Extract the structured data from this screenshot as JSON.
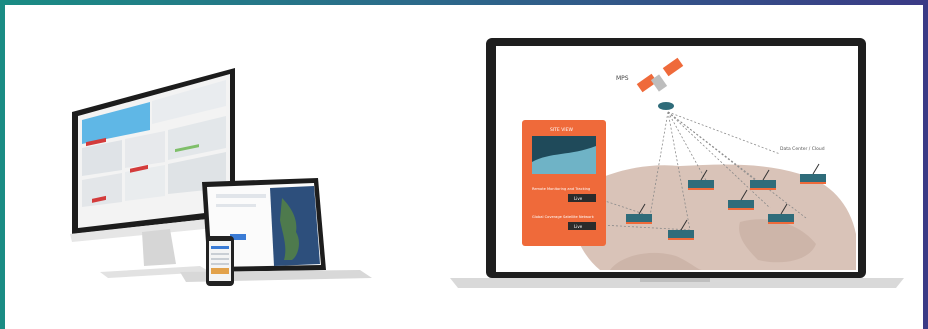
{
  "colors": {
    "border_left": "#1a8c84",
    "border_top_right": "#3b3a86",
    "accent_orange": "#ef6a3a",
    "map_land": "#d9c3b8",
    "teal_node": "#2f6c7a"
  },
  "left_scene": {
    "monitor": {
      "name": "desktop-monitor-dashboard"
    },
    "laptop": {
      "name": "laptop-map-view"
    },
    "phone": {
      "name": "phone-list-view"
    }
  },
  "right_scene": {
    "sat_label": "MPS",
    "panel_title": "SITE VIEW",
    "panel_caption_1": "Remote Monitoring and Tracking",
    "panel_caption_2": "Global Coverage Satellite Network",
    "panel_badge_1": "Live",
    "panel_badge_2": "Live",
    "hub_label": "Data Center / Cloud"
  }
}
